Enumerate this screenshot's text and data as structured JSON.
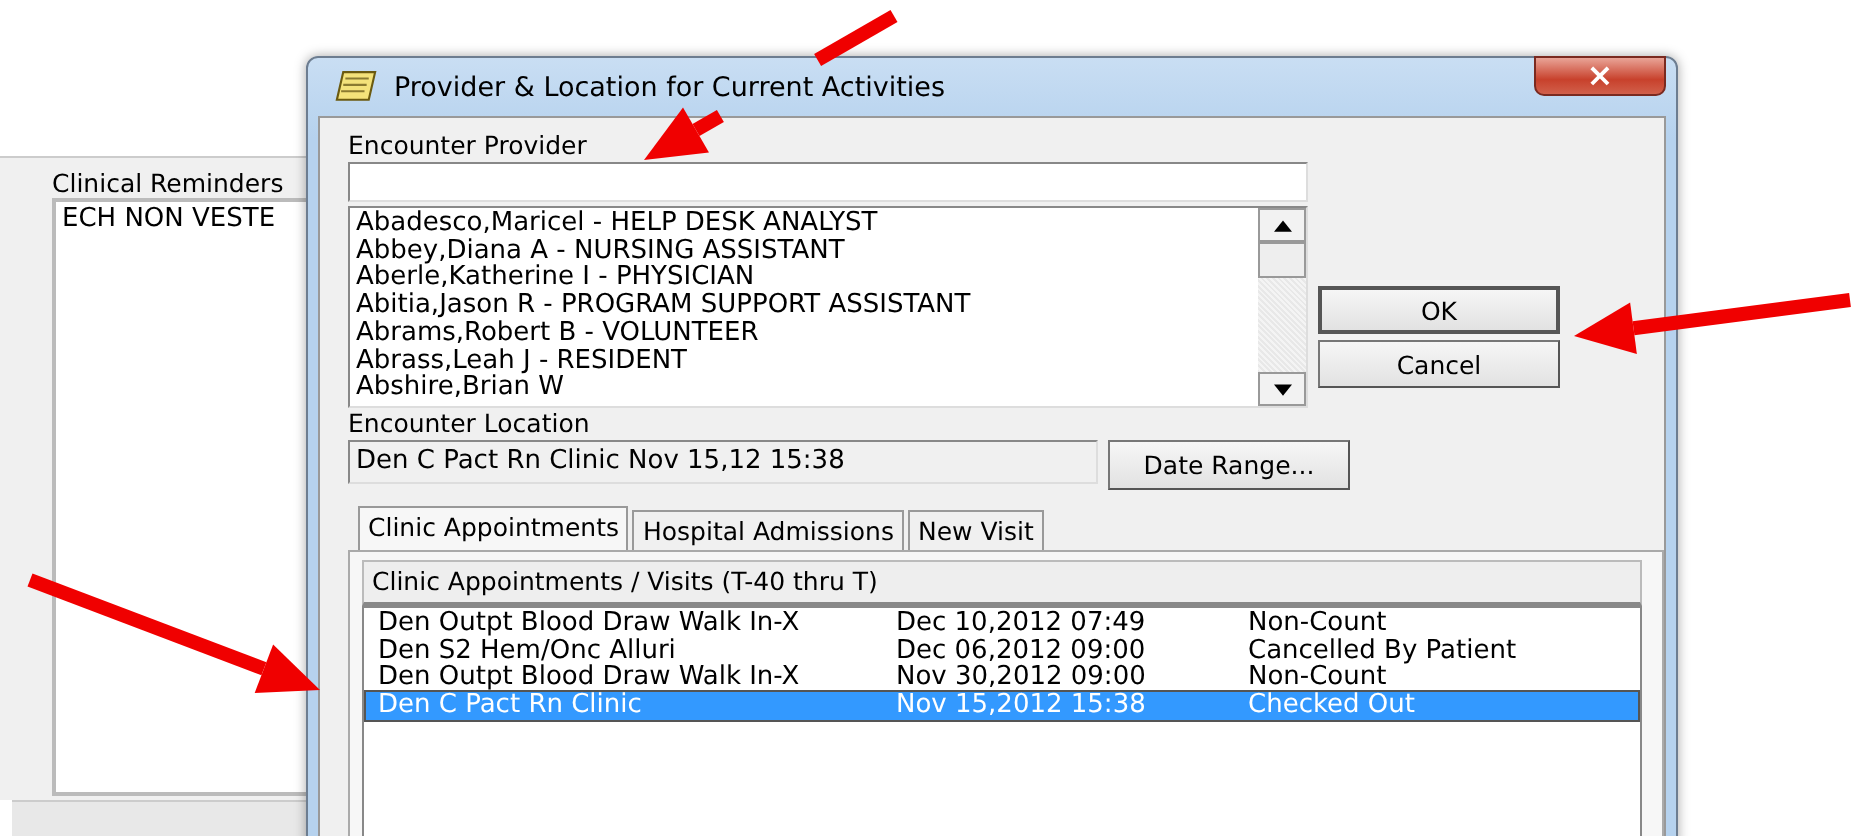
{
  "background_window": {
    "panel_label": "Clinical Reminders",
    "reminders": [
      "ECH NON VESTE"
    ]
  },
  "dialog": {
    "title": "Provider & Location for Current Activities",
    "close": "×",
    "provider_label": "Encounter Provider",
    "providers": [
      {
        "label": "Abadesco,Maricel - HELP DESK ANALYST",
        "selected": false
      },
      {
        "label": "Abbey,Diana A - NURSING ASSISTANT",
        "selected": false
      },
      {
        "label": "Aberle,Katherine I - PHYSICIAN",
        "selected": false
      },
      {
        "label": "Abitia,Jason R - PROGRAM SUPPORT ASSISTANT",
        "selected": false
      },
      {
        "label": "Abrams,Robert B - VOLUNTEER",
        "selected": false
      },
      {
        "label": "Abrass,Leah J - RESIDENT",
        "selected": false
      },
      {
        "label": "Abshire,Brian W",
        "selected": false
      }
    ],
    "buttons": [
      "OK",
      "Cancel"
    ],
    "location_label": "Encounter Location",
    "location_value": "Den C Pact Rn Clinic  Nov 15,12 15:38",
    "date_range_button": "Date Range...",
    "tabs": [
      {
        "label": "Clinic Appointments",
        "selected": true
      },
      {
        "label": "Hospital Admissions",
        "selected": false
      },
      {
        "label": "New Visit",
        "selected": false
      }
    ],
    "list_header": "Clinic Appointments / Visits  (T-40 thru T)",
    "appointments": [
      {
        "clinic": "Den Outpt Blood Draw Walk In-X",
        "date": "Dec 10,2012 07:49",
        "status": "Non-Count",
        "selected": false
      },
      {
        "clinic": "Den S2 Hem/Onc Alluri",
        "date": "Dec 06,2012 09:00",
        "status": "Cancelled By Patient",
        "selected": false
      },
      {
        "clinic": "Den Outpt Blood Draw Walk In-X",
        "date": "Nov 30,2012 09:00",
        "status": "Non-Count",
        "selected": false
      },
      {
        "clinic": "Den C Pact Rn Clinic",
        "date": "Nov 15,2012 15:38",
        "status": "Checked Out",
        "selected": true
      }
    ]
  },
  "annotations": [
    {
      "kind": "arrow"
    },
    {
      "kind": "arrow"
    },
    {
      "kind": "arrow"
    }
  ]
}
